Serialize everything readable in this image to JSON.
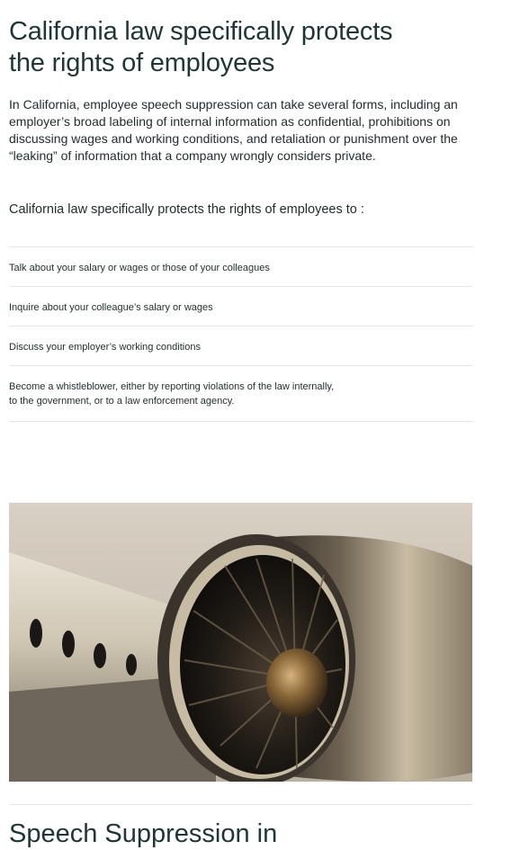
{
  "heading": "California law specifically protects the rights of employees",
  "intro": "In California, employee speech suppression can take several forms, including an employer’s broad labeling of internal information as confidential, prohibitions on discussing wages and working conditions, and retaliation or punishment over the “leaking” of information that a company wrongly considers private.",
  "lead": "California law specifically protects the rights of employees to :",
  "rights": [
    "Talk about your salary or wages or those of your colleagues",
    "Inquire about your colleague’s salary or wages",
    "Discuss your employer’s working conditions",
    "Become a whistleblower, either by reporting violations of the law internally,\nto the government, or to a law enforcement agency."
  ],
  "image": {
    "subject": "jet-engine-photo"
  },
  "next_heading": "Speech Suppression in"
}
